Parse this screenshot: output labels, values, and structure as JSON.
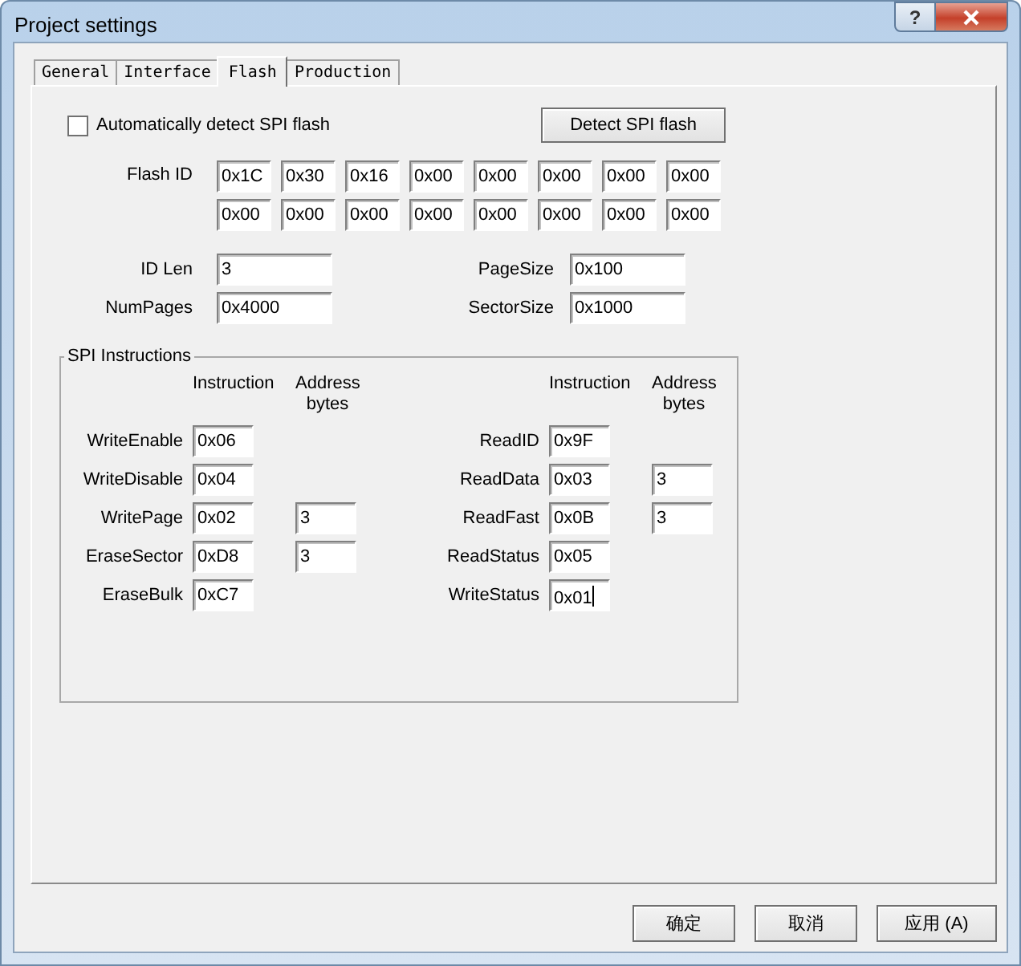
{
  "window": {
    "title": "Project settings",
    "help_button": "?"
  },
  "tabs": [
    {
      "label": "General",
      "selected": false
    },
    {
      "label": "Interface",
      "selected": false
    },
    {
      "label": "Flash",
      "selected": true
    },
    {
      "label": "Production",
      "selected": false
    }
  ],
  "auto_detect": {
    "label": "Automatically detect SPI flash",
    "checked": false
  },
  "detect_button": "Detect SPI flash",
  "flash_id": {
    "label": "Flash ID",
    "bytes": [
      "0x1C",
      "0x30",
      "0x16",
      "0x00",
      "0x00",
      "0x00",
      "0x00",
      "0x00",
      "0x00",
      "0x00",
      "0x00",
      "0x00",
      "0x00",
      "0x00",
      "0x00",
      "0x00"
    ]
  },
  "geometry": [
    {
      "label": "ID Len",
      "value": "3"
    },
    {
      "label": "PageSize",
      "value": "0x100"
    },
    {
      "label": "NumPages",
      "value": "0x4000"
    },
    {
      "label": "SectorSize",
      "value": "0x1000"
    }
  ],
  "spi": {
    "title": "SPI Instructions",
    "columns": [
      {
        "headers": [
          "Instruction",
          "Address bytes"
        ],
        "rows": [
          {
            "label": "WriteEnable",
            "instruction": "0x06",
            "focused": false
          },
          {
            "label": "WriteDisable",
            "instruction": "0x04",
            "focused": false
          },
          {
            "label": "WritePage",
            "instruction": "0x02",
            "address_bytes": "3",
            "focused": false
          },
          {
            "label": "EraseSector",
            "instruction": "0xD8",
            "address_bytes": "3",
            "focused": false
          },
          {
            "label": "EraseBulk",
            "instruction": "0xC7",
            "focused": false
          }
        ]
      },
      {
        "headers": [
          "Instruction",
          "Address bytes"
        ],
        "rows": [
          {
            "label": "ReadID",
            "instruction": "0x9F",
            "focused": false
          },
          {
            "label": "ReadData",
            "instruction": "0x03",
            "address_bytes": "3",
            "focused": false
          },
          {
            "label": "ReadFast",
            "instruction": "0x0B",
            "address_bytes": "3",
            "focused": false
          },
          {
            "label": "ReadStatus",
            "instruction": "0x05",
            "focused": false
          },
          {
            "label": "WriteStatus",
            "instruction": "0x01",
            "focused": true
          }
        ]
      }
    ]
  },
  "buttons": [
    "确定",
    "取消",
    "应用 (A)"
  ]
}
